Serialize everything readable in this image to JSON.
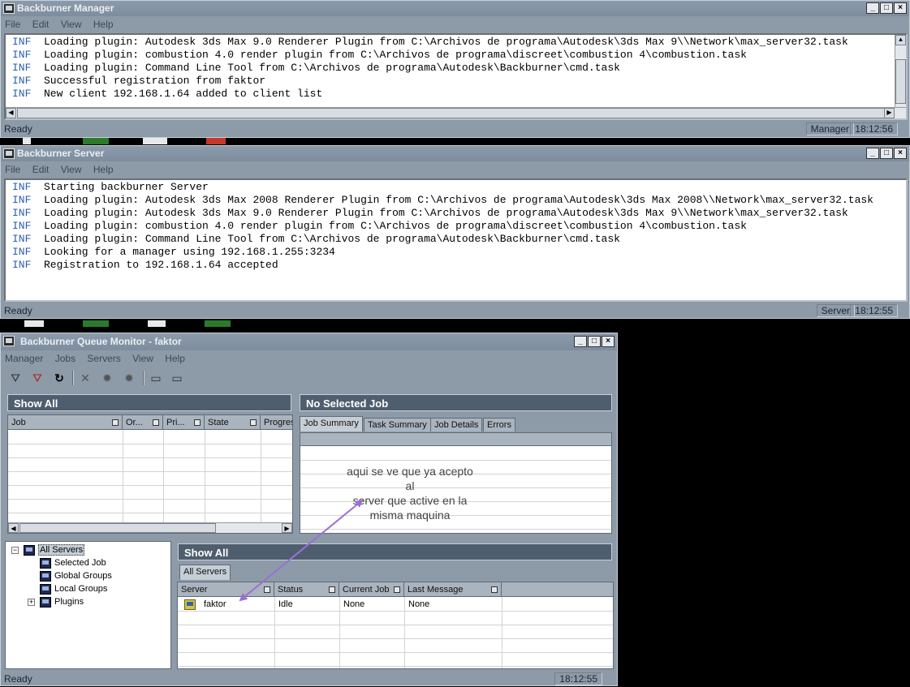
{
  "manager_window": {
    "title": "Backburner Manager",
    "menu": [
      "File",
      "Edit",
      "View",
      "Help"
    ],
    "log": [
      {
        "level": "INF",
        "text": "Loading plugin: Autodesk 3ds Max 9.0 Renderer Plugin from C:\\Archivos de programa\\Autodesk\\3ds Max 9\\\\Network\\max_server32.task"
      },
      {
        "level": "INF",
        "text": "Loading plugin: combustion 4.0 render plugin from C:\\Archivos de programa\\discreet\\combustion 4\\combustion.task"
      },
      {
        "level": "INF",
        "text": "Loading plugin: Command Line Tool from C:\\Archivos de programa\\Autodesk\\Backburner\\cmd.task"
      },
      {
        "level": "INF",
        "text": "Successful registration from faktor"
      },
      {
        "level": "INF",
        "text": "New client 192.168.1.64 added to client list"
      }
    ],
    "status": "Ready",
    "mode": "Manager",
    "time": "18:12:56"
  },
  "server_window": {
    "title": "Backburner Server",
    "menu": [
      "File",
      "Edit",
      "View",
      "Help"
    ],
    "log": [
      {
        "level": "INF",
        "text": "Starting backburner Server"
      },
      {
        "level": "INF",
        "text": "Loading plugin: Autodesk 3ds Max 2008 Renderer Plugin from C:\\Archivos de programa\\Autodesk\\3ds Max 2008\\\\Network\\max_server32.task"
      },
      {
        "level": "INF",
        "text": "Loading plugin: Autodesk 3ds Max 9.0 Renderer Plugin from C:\\Archivos de programa\\Autodesk\\3ds Max 9\\\\Network\\max_server32.task"
      },
      {
        "level": "INF",
        "text": "Loading plugin: combustion 4.0 render plugin from C:\\Archivos de programa\\discreet\\combustion 4\\combustion.task"
      },
      {
        "level": "INF",
        "text": "Loading plugin: Command Line Tool from C:\\Archivos de programa\\Autodesk\\Backburner\\cmd.task"
      },
      {
        "level": "INF",
        "text": "Looking for a manager using 192.168.1.255:3234"
      },
      {
        "level": "INF",
        "text": "Registration to 192.168.1.64 accepted"
      }
    ],
    "status": "Ready",
    "mode": "Server",
    "time": "18:12:55"
  },
  "monitor_window": {
    "title": "Backburner Queue Monitor - faktor",
    "menu": [
      "Manager",
      "Jobs",
      "Servers",
      "View",
      "Help"
    ],
    "toolbar_icons": [
      "filter-icon",
      "filter-remove-icon",
      "refresh-icon",
      "delete-icon",
      "server-connect-icon",
      "server-disconnect-icon",
      "monitor-icon",
      "monitor-alt-icon"
    ],
    "jobs_panel": {
      "header": "Show All",
      "columns": [
        "Job",
        "Or...",
        "Pri...",
        "State",
        "Progres"
      ]
    },
    "job_detail_panel": {
      "header": "No Selected Job",
      "tabs": [
        "Job Summary",
        "Task Summary",
        "Job Details",
        "Errors"
      ]
    },
    "tree": {
      "root": "All Servers",
      "children": [
        "Selected Job",
        "Global Groups",
        "Local Groups",
        "Plugins"
      ]
    },
    "servers_panel": {
      "header": "Show All",
      "tab": "All Servers",
      "columns": [
        "Server",
        "Status",
        "Current Job",
        "Last Message"
      ],
      "rows": [
        {
          "server": "faktor",
          "status": "Idle",
          "current_job": "None",
          "last_message": "None"
        }
      ]
    },
    "status": "Ready",
    "time": "18:12:55"
  },
  "annotation": {
    "lines": [
      "aqui se ve que ya acepto al",
      "server que active en la",
      "misma maquina"
    ],
    "arrow_color": "#9b6fd4"
  }
}
